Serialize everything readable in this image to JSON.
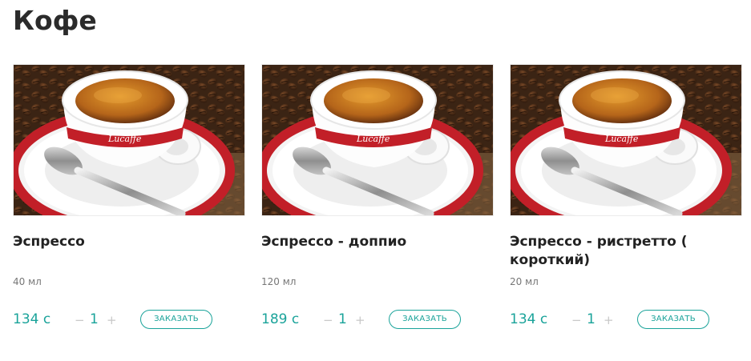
{
  "page": {
    "title": "Кофе"
  },
  "products": [
    {
      "name": "Эспрессо",
      "volume": "40 мл",
      "price": "134 с",
      "quantity": "1",
      "minus": "−",
      "plus": "+",
      "order_label": "ЗАКАЗАТЬ"
    },
    {
      "name": "Эспрессо - доппио",
      "volume": "120 мл",
      "price": "189 с",
      "quantity": "1",
      "minus": "−",
      "plus": "+",
      "order_label": "ЗАКАЗАТЬ"
    },
    {
      "name": "Эспрессо - ристретто ( короткий)",
      "volume": "20 мл",
      "price": "134 с",
      "quantity": "1",
      "minus": "−",
      "plus": "+",
      "order_label": "ЗАКАЗАТЬ"
    }
  ],
  "colors": {
    "accent": "#1aa39a",
    "title": "#2b2b2b",
    "muted": "#777777"
  },
  "icons": {
    "photo": "espresso-cup-photo"
  }
}
